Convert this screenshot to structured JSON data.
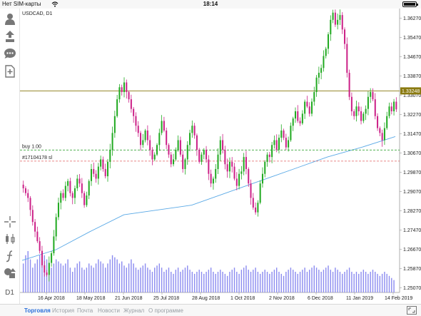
{
  "status_bar": {
    "carrier": "Нет SIM-карты",
    "time": "18:14"
  },
  "toolbar": {
    "timeframe": "D1",
    "icons": [
      "account-icon",
      "trade-icon",
      "chat-icon",
      "add-chart-icon",
      "crosshair-icon",
      "chart-type-icon",
      "indicator-icon",
      "objects-icon"
    ]
  },
  "chart": {
    "symbol": "USDCAD",
    "timeframe": "D1",
    "symbol_label": "USDCAD, D1",
    "price_ticks": [
      "1.36270",
      "1.35470",
      "1.34670",
      "1.33870",
      "1.33070",
      "1.32270",
      "1.31470",
      "1.30670",
      "1.29870",
      "1.29070",
      "1.28270",
      "1.27470",
      "1.26670",
      "1.25870",
      "1.25070"
    ],
    "date_ticks": [
      "16 Apr 2018",
      "18 May 2018",
      "21 Jun 2018",
      "25 Jul 2018",
      "28 Aug 2018",
      "1 Oct 2018",
      "2 Nov 2018",
      "6 Dec 2018",
      "11 Jan 2019",
      "14 Feb 2019"
    ],
    "current_price": "1.33248",
    "buy_label": "buy 1.00",
    "sl_label": "#17104178 sl",
    "colors": {
      "bull": "#22aa22",
      "bear": "#cc2288",
      "ma": "#5aa9e6",
      "current": "#8a7a10",
      "buy_line": "#3aa63a",
      "sl_line": "#e06060",
      "volume": "#8c8cf0"
    }
  },
  "chart_data": {
    "type": "candlestick",
    "ylim": [
      1.2487,
      1.3667
    ],
    "ma_levels": [
      1.262,
      1.2665,
      1.274,
      1.281,
      1.283,
      1.285,
      1.29,
      1.295,
      1.3,
      1.305,
      1.309,
      1.3135
    ],
    "closes": [
      1.292,
      1.29,
      1.288,
      1.283,
      1.278,
      1.274,
      1.27,
      1.266,
      1.26,
      1.257,
      1.256,
      1.261,
      1.265,
      1.272,
      1.28,
      1.286,
      1.29,
      1.288,
      1.293,
      1.295,
      1.29,
      1.288,
      1.292,
      1.296,
      1.294,
      1.29,
      1.285,
      1.289,
      1.295,
      1.3,
      1.298,
      1.296,
      1.301,
      1.304,
      1.3,
      1.297,
      1.303,
      1.308,
      1.315,
      1.322,
      1.329,
      1.334,
      1.332,
      1.336,
      1.332,
      1.329,
      1.325,
      1.322,
      1.318,
      1.315,
      1.31,
      1.312,
      1.316,
      1.312,
      1.308,
      1.304,
      1.306,
      1.31,
      1.315,
      1.32,
      1.316,
      1.31,
      1.306,
      1.302,
      1.304,
      1.308,
      1.312,
      1.306,
      1.3,
      1.304,
      1.31,
      1.315,
      1.318,
      1.314,
      1.308,
      1.303,
      1.306,
      1.308,
      1.304,
      1.298,
      1.294,
      1.296,
      1.3,
      1.306,
      1.312,
      1.308,
      1.302,
      1.299,
      1.303,
      1.301,
      1.296,
      1.293,
      1.298,
      1.299,
      1.305,
      1.3,
      1.294,
      1.288,
      1.284,
      1.282,
      1.286,
      1.294,
      1.298,
      1.303,
      1.306,
      1.305,
      1.31,
      1.312,
      1.308,
      1.313,
      1.316,
      1.313,
      1.309,
      1.312,
      1.318,
      1.321,
      1.324,
      1.32,
      1.319,
      1.323,
      1.328,
      1.326,
      1.323,
      1.328,
      1.332,
      1.338,
      1.34,
      1.342,
      1.347,
      1.35,
      1.356,
      1.362,
      1.365,
      1.36,
      1.362,
      1.364,
      1.358,
      1.352,
      1.34,
      1.33,
      1.324,
      1.322,
      1.326,
      1.324,
      1.32,
      1.323,
      1.325,
      1.33,
      1.332,
      1.329,
      1.322,
      1.317,
      1.315,
      1.312,
      1.317,
      1.322,
      1.326,
      1.324,
      1.328,
      1.3248
    ],
    "volumes": [
      0.7,
      0.9,
      1.0,
      0.8,
      0.6,
      0.7,
      0.8,
      0.9,
      1.0,
      0.9,
      0.8,
      0.7,
      0.6,
      0.7,
      0.8,
      0.75,
      0.7,
      0.65,
      0.7,
      0.8,
      0.6,
      0.5,
      0.6,
      0.7,
      0.75,
      0.6,
      0.55,
      0.6,
      0.7,
      0.65,
      0.6,
      0.7,
      0.8,
      0.75,
      0.7,
      0.6,
      0.7,
      0.8,
      0.9,
      0.85,
      0.8,
      0.7,
      0.75,
      0.65,
      0.6,
      0.7,
      0.8,
      0.7,
      0.6,
      0.55,
      0.6,
      0.65,
      0.7,
      0.6,
      0.55,
      0.5,
      0.6,
      0.65,
      0.7,
      0.6,
      0.5,
      0.55,
      0.6,
      0.5,
      0.45,
      0.55,
      0.6,
      0.5,
      0.55,
      0.6,
      0.65,
      0.55,
      0.5,
      0.45,
      0.5,
      0.55,
      0.5,
      0.45,
      0.5,
      0.55,
      0.6,
      0.5,
      0.45,
      0.5,
      0.55,
      0.5,
      0.45,
      0.4,
      0.5,
      0.55,
      0.6,
      0.5,
      0.45,
      0.55,
      0.6,
      0.65,
      0.55,
      0.5,
      0.55,
      0.6,
      0.5,
      0.45,
      0.5,
      0.55,
      0.5,
      0.45,
      0.5,
      0.55,
      0.6,
      0.5,
      0.45,
      0.4,
      0.5,
      0.55,
      0.6,
      0.55,
      0.5,
      0.45,
      0.5,
      0.55,
      0.6,
      0.5,
      0.55,
      0.6,
      0.65,
      0.6,
      0.55,
      0.5,
      0.55,
      0.6,
      0.65,
      0.55,
      0.5,
      0.6,
      0.55,
      0.5,
      0.45,
      0.5,
      0.55,
      0.6,
      0.5,
      0.45,
      0.5,
      0.45,
      0.5,
      0.55,
      0.5,
      0.45,
      0.5,
      0.55,
      0.5,
      0.45,
      0.4,
      0.45,
      0.5,
      0.45,
      0.4,
      0.35,
      0.3
    ],
    "current_price": 1.33248,
    "buy_price": 1.3079,
    "stop_loss_price": 1.3033
  },
  "tabs": [
    {
      "label": "Торговля",
      "active": true
    },
    {
      "label": "История",
      "active": false
    },
    {
      "label": "Почта",
      "active": false
    },
    {
      "label": "Новости",
      "active": false
    },
    {
      "label": "Журнал",
      "active": false
    },
    {
      "label": "О программе",
      "active": false
    }
  ]
}
